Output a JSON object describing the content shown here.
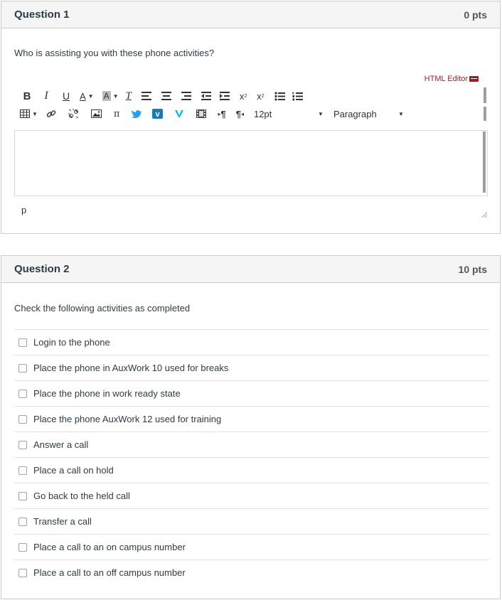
{
  "q1": {
    "title": "Question 1",
    "points": "0 pts",
    "text": "Who is assisting you with these phone activities?",
    "html_editor_label": "HTML Editor",
    "toolbar": {
      "bold": "B",
      "italic": "I",
      "underline": "U",
      "font_color": "A",
      "bg_color": "A",
      "clear_format": "T",
      "superscript": "x",
      "subscript": "x",
      "ltr": "¶",
      "rtl": "¶",
      "font_size": "12pt",
      "format": "Paragraph"
    },
    "status_path": "p"
  },
  "q2": {
    "title": "Question 2",
    "points": "10 pts",
    "text": "Check the following activities as completed",
    "answers": [
      "Login to the phone",
      "Place the phone in AuxWork 10 used for breaks",
      "Place the phone in work ready state",
      "Place the phone AuxWork 12 used for training",
      "Answer a call",
      "Place a call on hold",
      "Go back to the held call",
      "Transfer a call",
      "Place a call to an on campus number",
      "Place a call to an off campus number"
    ]
  },
  "colors": {
    "accent_red": "#a11b25",
    "vimeo_blue": "#1ab7ea",
    "twitter_blue": "#1da1f2",
    "text": "#2d3b45"
  }
}
